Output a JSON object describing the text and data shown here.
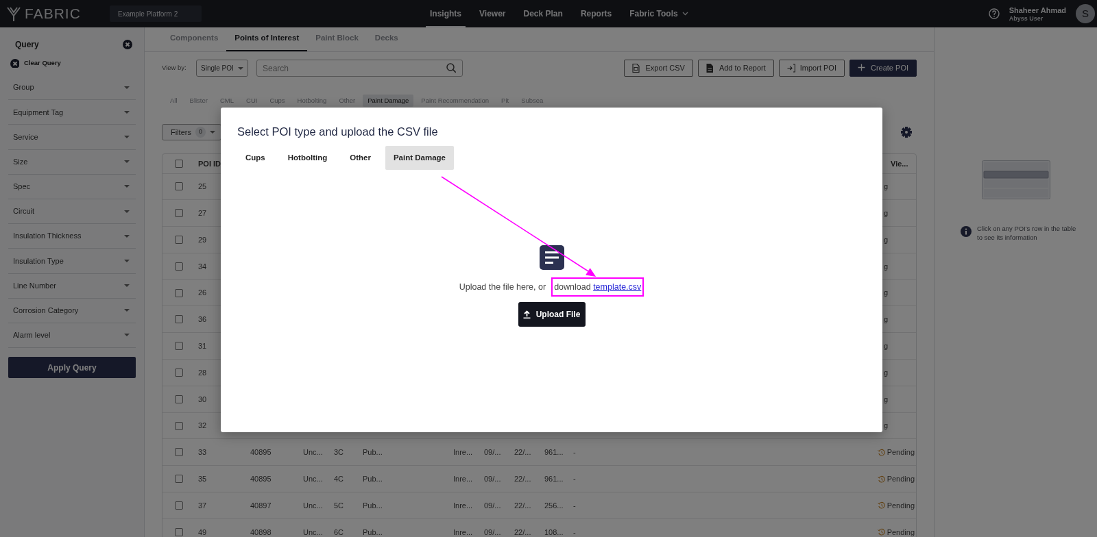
{
  "navbar": {
    "logo": "FABRIC",
    "platform": "Example Platform 2",
    "links": [
      {
        "label": "Insights",
        "selected": true,
        "dropdown": false
      },
      {
        "label": "Viewer",
        "selected": false,
        "dropdown": false
      },
      {
        "label": "Deck Plan",
        "selected": false,
        "dropdown": false
      },
      {
        "label": "Reports",
        "selected": false,
        "dropdown": false
      },
      {
        "label": "Fabric Tools",
        "selected": false,
        "dropdown": true
      }
    ],
    "user": {
      "name": "Shaheer Ahmad",
      "role": "Abyss User",
      "initial": "S"
    }
  },
  "sidebar": {
    "title": "Query",
    "clear_label": "Clear Query",
    "filters": [
      "Group",
      "Equipment Tag",
      "Service",
      "Size",
      "Spec",
      "Circuit",
      "Insulation Thickness",
      "Insulation Type",
      "Line Number",
      "Corrosion Category",
      "Alarm level"
    ],
    "apply_label": "Apply Query"
  },
  "content_tabs": [
    {
      "label": "Components",
      "selected": false
    },
    {
      "label": "Points of Interest",
      "selected": true
    },
    {
      "label": "Paint Block",
      "selected": false
    },
    {
      "label": "Decks",
      "selected": false
    }
  ],
  "toolbar": {
    "view_by_label": "View by:",
    "view_by_value": "Single POI",
    "search_placeholder": "Search",
    "buttons": [
      {
        "label": "Export CSV",
        "kind": "csv"
      },
      {
        "label": "Add to Report",
        "kind": "report"
      },
      {
        "label": "Import POI",
        "kind": "import"
      },
      {
        "label": "Create POI",
        "kind": "create"
      }
    ]
  },
  "categories": [
    {
      "label": "All",
      "selected": false
    },
    {
      "label": "Blister",
      "selected": false
    },
    {
      "label": "CML",
      "selected": false
    },
    {
      "label": "CUI",
      "selected": false
    },
    {
      "label": "Cups",
      "selected": false
    },
    {
      "label": "Hotbolting",
      "selected": false
    },
    {
      "label": "Other",
      "selected": false
    },
    {
      "label": "Paint Damage",
      "selected": true
    },
    {
      "label": "Paint Recommendation",
      "selected": false
    },
    {
      "label": "Pit",
      "selected": false
    },
    {
      "label": "Subsea",
      "selected": false
    }
  ],
  "filters_button": {
    "label": "Filters",
    "count": "0"
  },
  "table": {
    "columns": [
      "POI ID",
      "Vie..."
    ],
    "all_checked": false,
    "rows": [
      {
        "checked": false,
        "cells": [
          "25"
        ],
        "status": "g"
      },
      {
        "checked": false,
        "cells": [
          "27"
        ],
        "status": "g"
      },
      {
        "checked": false,
        "cells": [
          "29"
        ],
        "status": "g"
      },
      {
        "checked": false,
        "cells": [
          "34"
        ],
        "status": "g"
      },
      {
        "checked": false,
        "cells": [
          "26"
        ],
        "status": "g"
      },
      {
        "checked": false,
        "cells": [
          "36"
        ],
        "status": "g"
      },
      {
        "checked": false,
        "cells": [
          "31"
        ],
        "status": "g"
      },
      {
        "checked": false,
        "cells": [
          "28"
        ],
        "status": "g"
      },
      {
        "checked": false,
        "cells": [
          "30"
        ],
        "status": "g"
      },
      {
        "checked": false,
        "cells": [
          "32"
        ],
        "status": "g"
      },
      {
        "checked": false,
        "cells": [
          "33",
          "40895",
          "Unc...",
          "3C",
          "Pub...",
          "Inre...",
          "09/...",
          "22/...",
          "961...",
          "-"
        ],
        "status": "Pending",
        "status_icon": true
      },
      {
        "checked": false,
        "cells": [
          "35",
          "40895",
          "Unc...",
          "4C",
          "Pub...",
          "Inre...",
          "09/...",
          "22/...",
          "961...",
          "-"
        ],
        "status": "Pending",
        "status_icon": true
      },
      {
        "checked": false,
        "cells": [
          "37",
          "40897",
          "Unc...",
          "5C",
          "Pub...",
          "Inre...",
          "09/...",
          "22/...",
          "256...",
          "-"
        ],
        "status": "Pending",
        "status_icon": true
      },
      {
        "checked": false,
        "cells": [
          "49",
          "40898",
          "Unc...",
          "6C",
          "Pub...",
          "Inre...",
          "09/...",
          "22/...",
          "108...",
          "-"
        ],
        "status": "Pending",
        "status_icon": true
      }
    ]
  },
  "info_panel": {
    "hint": "Click on any POI's row in the table to see its information"
  },
  "modal": {
    "title": "Select POI type and upload the CSV file",
    "tabs": [
      {
        "label": "Cups",
        "selected": false
      },
      {
        "label": "Hotbolting",
        "selected": false
      },
      {
        "label": "Other",
        "selected": false
      },
      {
        "label": "Paint Damage",
        "selected": true
      }
    ],
    "prompt": "Upload the file here, or",
    "link_prompt": "download",
    "link": "template.csv",
    "upload_label": "Upload File"
  }
}
